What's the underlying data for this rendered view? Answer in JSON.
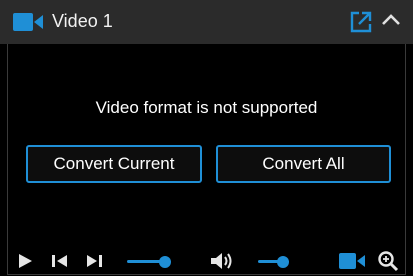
{
  "header": {
    "title": "Video 1"
  },
  "main": {
    "message": "Video format is not supported",
    "convert_current_label": "Convert Current",
    "convert_all_label": "Convert All"
  },
  "controls": {
    "icons": [
      "play-icon",
      "skip-previous-icon",
      "skip-next-icon",
      "volume-icon",
      "camera-icon",
      "zoom-icon"
    ],
    "progress_level": 0.7,
    "volume_level": 0.55
  },
  "colors": {
    "accent": "#1f8fd6",
    "header_bg": "#2b2b2b",
    "background": "#000000",
    "text": "#ffffff"
  }
}
